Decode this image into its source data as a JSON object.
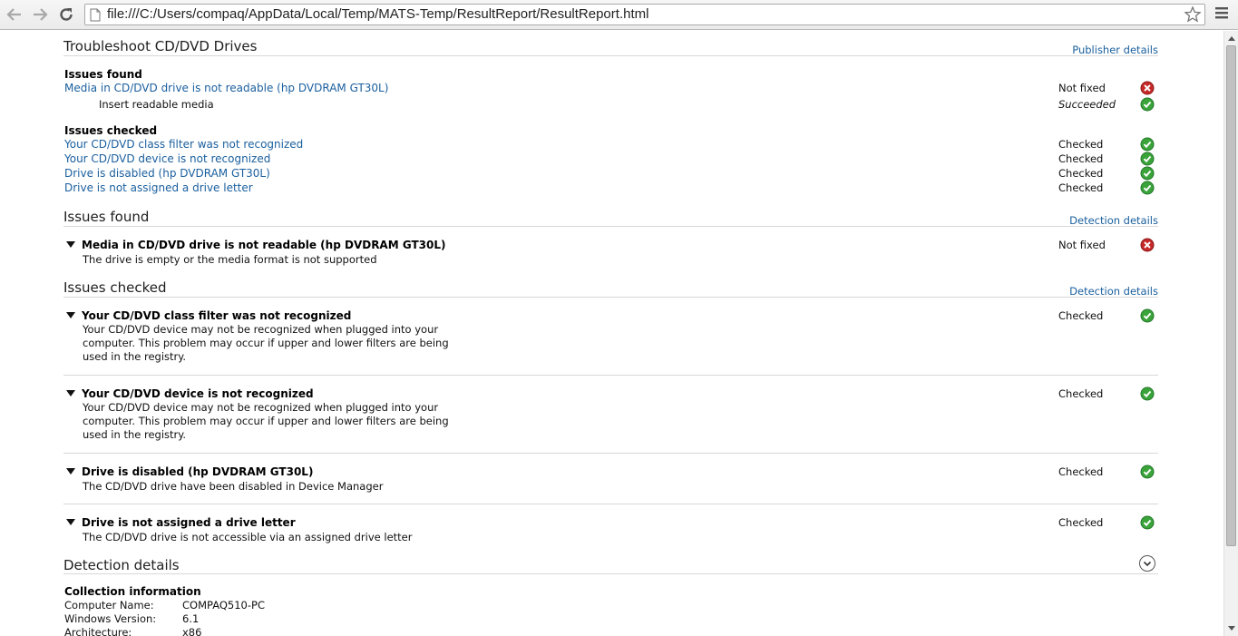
{
  "browser": {
    "url": "file:///C:/Users/compaq/AppData/Local/Temp/MATS-Temp/ResultReport/ResultReport.html"
  },
  "summary": {
    "title": "Troubleshoot CD/DVD Drives",
    "publisher_link": "Publisher details",
    "issues_found_heading": "Issues found",
    "issues_found": [
      {
        "label": "Media in CD/DVD drive is not readable (hp DVDRAM GT30L)",
        "status": "Not fixed",
        "icon": "error-icon"
      }
    ],
    "fix": {
      "label": "Insert readable media",
      "status": "Succeeded",
      "icon": "check-icon"
    },
    "issues_checked_heading": "Issues checked",
    "issues_checked": [
      {
        "label": "Your CD/DVD class filter was not recognized",
        "status": "Checked",
        "icon": "check-icon"
      },
      {
        "label": "Your CD/DVD device is not recognized",
        "status": "Checked",
        "icon": "check-icon"
      },
      {
        "label": "Drive is disabled (hp DVDRAM GT30L)",
        "status": "Checked",
        "icon": "check-icon"
      },
      {
        "label": "Drive is not assigned a drive letter",
        "status": "Checked",
        "icon": "check-icon"
      }
    ]
  },
  "found_section": {
    "title": "Issues found",
    "link": "Detection details",
    "items": [
      {
        "title": "Media in CD/DVD drive is not readable (hp DVDRAM GT30L)",
        "desc": "The drive is empty or the media format is not supported",
        "status": "Not fixed",
        "icon": "error-icon"
      }
    ]
  },
  "checked_section": {
    "title": "Issues checked",
    "link": "Detection details",
    "items": [
      {
        "title": "Your CD/DVD class filter was not recognized",
        "desc": "Your CD/DVD device may not be recognized when plugged into your computer. This problem may occur if upper and lower filters are being used in the registry.",
        "status": "Checked",
        "icon": "check-icon"
      },
      {
        "title": "Your CD/DVD device is not recognized",
        "desc": "Your CD/DVD device may not be recognized when plugged into your computer. This problem may occur if upper and lower filters are being used in the registry.",
        "status": "Checked",
        "icon": "check-icon"
      },
      {
        "title": "Drive is disabled (hp DVDRAM GT30L)",
        "desc": "The CD/DVD drive have been disabled in Device Manager",
        "status": "Checked",
        "icon": "check-icon"
      },
      {
        "title": "Drive is not assigned a drive letter",
        "desc": "The CD/DVD drive is not accessible via an assigned drive letter",
        "status": "Checked",
        "icon": "check-icon"
      }
    ]
  },
  "detection": {
    "title": "Detection details",
    "collection_heading": "Collection information",
    "rows": [
      {
        "key": "Computer Name:",
        "value": "COMPAQ510-PC"
      },
      {
        "key": "Windows Version:",
        "value": "6.1"
      },
      {
        "key": "Architecture:",
        "value": "x86"
      }
    ]
  },
  "colors": {
    "link": "#1a5f9e",
    "error": "#c62828",
    "success": "#3aa33a"
  }
}
